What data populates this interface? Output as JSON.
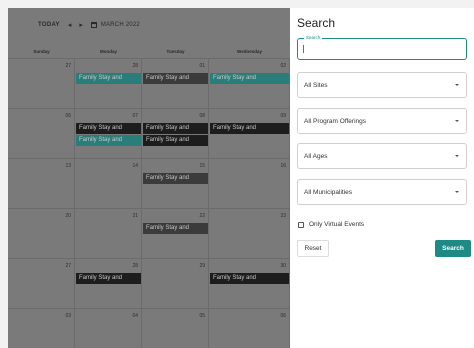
{
  "calendar": {
    "toolbar": {
      "today_label": "TODAY",
      "prev_glyph": "◂",
      "next_glyph": "▸",
      "calendar_icon": "calendar-icon",
      "month_label": "MARCH 2022"
    },
    "days_of_week": [
      "Sunday",
      "Monday",
      "Tuesday",
      "Wednesday"
    ],
    "weeks": [
      {
        "nums": [
          "27",
          "28",
          "01",
          "02"
        ],
        "events": [
          [
            "",
            "Family Stay and",
            "Family Stay and",
            "Family Stay and"
          ]
        ]
      },
      {
        "nums": [
          "06",
          "07",
          "08",
          "09"
        ],
        "events": [
          [
            "",
            "Family Stay and",
            "Family Stay and",
            "Family Stay and"
          ],
          [
            "",
            "Family Stay and",
            "Family Stay and",
            ""
          ]
        ]
      },
      {
        "nums": [
          "13",
          "14",
          "15",
          "16"
        ],
        "events": [
          [
            "",
            "",
            "Family Stay and",
            ""
          ]
        ]
      },
      {
        "nums": [
          "20",
          "21",
          "22",
          "23"
        ],
        "events": [
          [
            "",
            "",
            "Family Stay and",
            ""
          ]
        ]
      },
      {
        "nums": [
          "27",
          "28",
          "29",
          "30"
        ],
        "events": [
          [
            "",
            "Family Stay and",
            "",
            "Family Stay and"
          ]
        ]
      },
      {
        "nums": [
          "03",
          "04",
          "05",
          "06"
        ],
        "events": []
      }
    ]
  },
  "search_panel": {
    "title": "Search",
    "search_field": {
      "legend": "Search",
      "value": ""
    },
    "selects": [
      {
        "name": "sites-select",
        "label": "All Sites"
      },
      {
        "name": "program-offerings-select",
        "label": "All Program Offerings"
      },
      {
        "name": "ages-select",
        "label": "All Ages"
      },
      {
        "name": "municipalities-select",
        "label": "All Municipalities"
      }
    ],
    "virtual_checkbox_label": "Only Virtual Events",
    "virtual_checked": false,
    "reset_label": "Reset",
    "search_button_label": "Search"
  },
  "colors": {
    "accent": "#1e8a86",
    "event_teal": "#2a7e7a",
    "event_dark": "#1d1d1d",
    "event_gray": "#3b3b3b",
    "overlay": "#7a7a7a"
  }
}
